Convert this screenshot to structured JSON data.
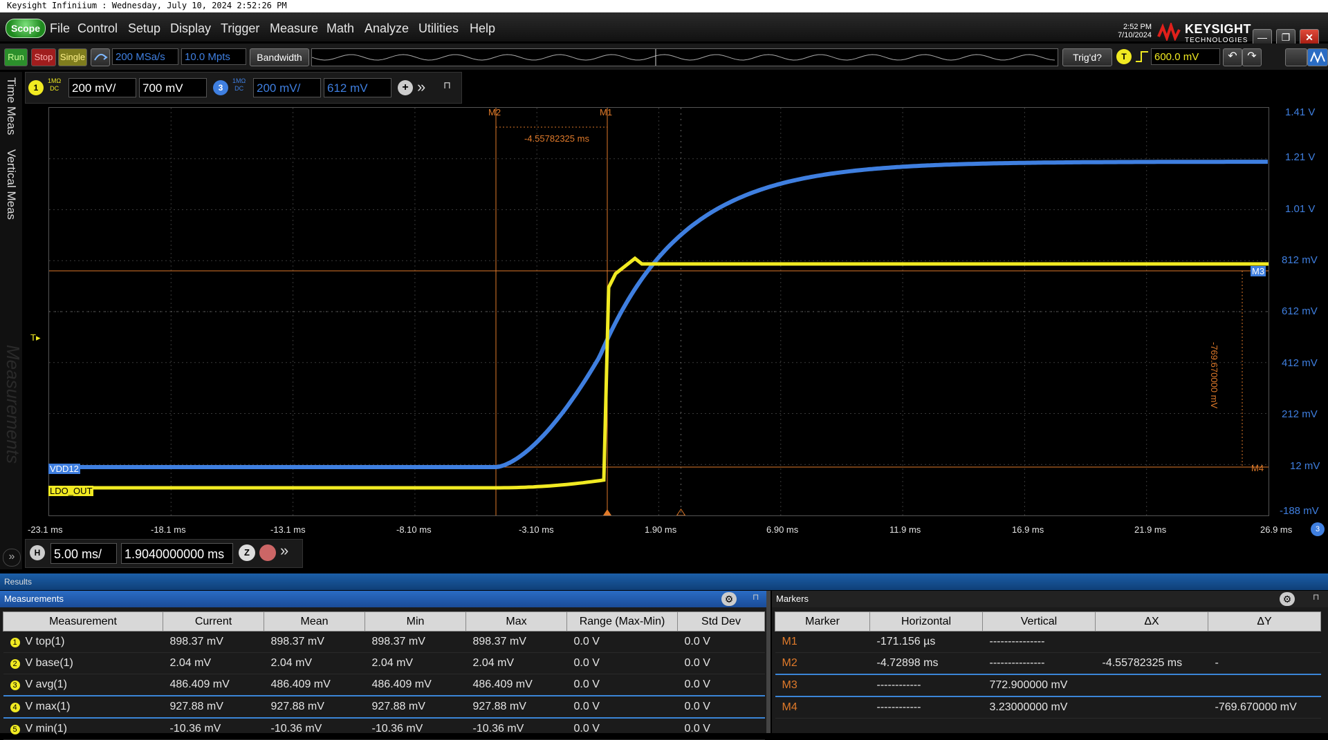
{
  "window": {
    "title": "Keysight Infiniium : Wednesday, July 10, 2024 2:52:26 PM"
  },
  "menu": {
    "logo": "Scope",
    "items": [
      "File",
      "Control",
      "Setup",
      "Display",
      "Trigger",
      "Measure",
      "Math",
      "Analyze",
      "Utilities",
      "Help"
    ],
    "time": "2:52 PM",
    "date": "7/10/2024",
    "brand": "KEYSIGHT",
    "brand_sub": "TECHNOLOGIES"
  },
  "toolbar": {
    "run": "Run",
    "stop": "Stop",
    "single": "Single",
    "sample_rate": "200 MSa/s",
    "memory_depth": "10.0 Mpts",
    "bandwidth": "Bandwidth",
    "trig_status": "Trig'd?",
    "trigger_badge": "T",
    "trigger_level": "600.0 mV"
  },
  "left_tabs": [
    "Time Meas",
    "Vertical Meas"
  ],
  "measurements_watermark": "Measurements",
  "channels": [
    {
      "number": "1",
      "impedance": "1MΩ",
      "coupling": "DC",
      "scale": "200 mV/",
      "offset": "700 mV",
      "color": "#f1ea22"
    },
    {
      "number": "3",
      "impedance": "1MΩ",
      "coupling": "DC",
      "scale": "200 mV/",
      "offset": "612 mV",
      "color": "#3f7fe0"
    }
  ],
  "plot": {
    "trigger_marker": "T",
    "y_labels": [
      "1.41 V",
      "1.21 V",
      "1.01 V",
      "812 mV",
      "612 mV",
      "412 mV",
      "212 mV",
      "12 mV",
      "-188 mV"
    ],
    "x_labels": [
      "-23.1 ms",
      "-18.1 ms",
      "-13.1 ms",
      "-8.10 ms",
      "-3.10 ms",
      "1.90 ms",
      "6.90 ms",
      "11.9 ms",
      "16.9 ms",
      "21.9 ms",
      "26.9 ms"
    ],
    "channel_labels": {
      "ch3": "VDD12",
      "ch1": "LDO_OUT"
    },
    "marker_labels": {
      "m1": "M1",
      "m2": "M2",
      "m3": "M3",
      "m4": "M4"
    },
    "delta_x": "-4.55782325 ms",
    "delta_y": "-769.670000 mV",
    "right_badge": "3",
    "colors": {
      "ch1": "#f1ea22",
      "ch3": "#3f7fe0",
      "marker": "#e07a2a"
    }
  },
  "horizontal": {
    "badge": "H",
    "scale": "5.00 ms/",
    "position": "1.9040000000 ms",
    "zoom": "Z"
  },
  "results": {
    "header": "Results",
    "measurements_title": "Measurements",
    "measurement_columns": [
      "Measurement",
      "Current",
      "Mean",
      "Min",
      "Max",
      "Range (Max-Min)",
      "Std Dev"
    ],
    "measurement_rows": [
      {
        "n": "1",
        "name": "V top(1)",
        "current": "898.37 mV",
        "mean": "898.37 mV",
        "min": "898.37 mV",
        "max": "898.37 mV",
        "range": "0.0 V",
        "std": "0.0 V"
      },
      {
        "n": "2",
        "name": "V base(1)",
        "current": "2.04 mV",
        "mean": "2.04 mV",
        "min": "2.04 mV",
        "max": "2.04 mV",
        "range": "0.0 V",
        "std": "0.0 V"
      },
      {
        "n": "3",
        "name": "V avg(1)",
        "current": "486.409 mV",
        "mean": "486.409 mV",
        "min": "486.409 mV",
        "max": "486.409 mV",
        "range": "0.0 V",
        "std": "0.0 V"
      },
      {
        "n": "4",
        "name": "V max(1)",
        "current": "927.88 mV",
        "mean": "927.88 mV",
        "min": "927.88 mV",
        "max": "927.88 mV",
        "range": "0.0 V",
        "std": "0.0 V"
      },
      {
        "n": "5",
        "name": "V min(1)",
        "current": "-10.36 mV",
        "mean": "-10.36 mV",
        "min": "-10.36 mV",
        "max": "-10.36 mV",
        "range": "0.0 V",
        "std": "0.0 V"
      }
    ],
    "markers_title": "Markers",
    "marker_columns": [
      "Marker",
      "Horizontal",
      "Vertical",
      "ΔX",
      "ΔY"
    ],
    "marker_rows": [
      {
        "name": "M1",
        "horizontal": "-171.156 µs",
        "vertical": "---------------",
        "dx": "",
        "dy": ""
      },
      {
        "name": "M2",
        "horizontal": "-4.72898 ms",
        "vertical": "---------------",
        "dx": "-4.55782325 ms",
        "dy": "-"
      },
      {
        "name": "M3",
        "horizontal": "------------",
        "vertical": "772.900000 mV",
        "dx": "",
        "dy": ""
      },
      {
        "name": "M4",
        "horizontal": "------------",
        "vertical": "3.23000000 mV",
        "dx": "",
        "dy": "-769.670000 mV"
      }
    ]
  }
}
